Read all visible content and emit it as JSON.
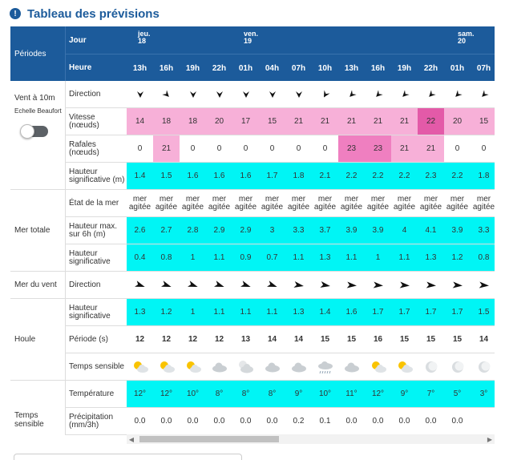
{
  "title": "Tableau des prévisions",
  "periods_header": "Périodes",
  "header": {
    "jour_label": "Jour",
    "heure_label": "Heure"
  },
  "days": [
    {
      "name": "jeu.",
      "date": "18"
    },
    {
      "name": "ven.",
      "date": "19"
    },
    {
      "name": "sam.",
      "date": "20"
    }
  ],
  "hours": [
    "13h",
    "16h",
    "19h",
    "22h",
    "01h",
    "04h",
    "07h",
    "10h",
    "13h",
    "16h",
    "19h",
    "22h",
    "01h",
    "07h"
  ],
  "sections": {
    "vent": {
      "title": "Vent à 10m",
      "subtitle": "Echelle Beaufort"
    },
    "mer_totale": "Mer totale",
    "mer_du_vent": "Mer du vent",
    "houle": "Houle",
    "temps": "Temps sensible"
  },
  "labels": {
    "direction": "Direction",
    "vitesse": "Vitesse (nœuds)",
    "rafales": "Rafales (nœuds)",
    "hauteur_sig": "Hauteur significative (m)",
    "etat_mer": "État de la mer",
    "hauteur_max": "Hauteur max. sur 6h (m)",
    "hauteur_sig_vent": "Hauteur significative",
    "houle_direction": "Direction",
    "houle_hauteur": "Hauteur significative",
    "periode": "Période (s)",
    "temps_sensible": "Temps sensible",
    "temperature": "Température",
    "precipitation": "Précipitation (mm/3h)"
  },
  "wind_direction_deg": [
    0,
    315,
    0,
    0,
    0,
    0,
    0,
    30,
    45,
    45,
    45,
    45,
    45,
    45
  ],
  "vitesse": [
    "14",
    "18",
    "18",
    "20",
    "17",
    "15",
    "21",
    "21",
    "21",
    "21",
    "21",
    "22",
    "20",
    "15"
  ],
  "rafales": [
    "0",
    "21",
    "0",
    "0",
    "0",
    "0",
    "0",
    "0",
    "23",
    "23",
    "21",
    "21",
    "0",
    "0"
  ],
  "hauteur_sig": [
    "1.4",
    "1.5",
    "1.6",
    "1.6",
    "1.6",
    "1.7",
    "1.8",
    "2.1",
    "2.2",
    "2.2",
    "2.2",
    "2.3",
    "2.2",
    "1.8"
  ],
  "etat_mer": {
    "line1": "mer",
    "line2": "agitée"
  },
  "hauteur_max": [
    "2.6",
    "2.7",
    "2.8",
    "2.9",
    "2.9",
    "3",
    "3.3",
    "3.7",
    "3.9",
    "3.9",
    "4",
    "4.1",
    "3.9",
    "3.3"
  ],
  "hauteur_sig_vent": [
    "0.4",
    "0.8",
    "1",
    "1.1",
    "0.9",
    "0.7",
    "1.1",
    "1.3",
    "1.1",
    "1",
    "1.1",
    "1.3",
    "1.2",
    "0.8"
  ],
  "houle_direction_deg": [
    110,
    110,
    110,
    110,
    110,
    110,
    100,
    100,
    95,
    95,
    95,
    95,
    95,
    95
  ],
  "houle_hauteur": [
    "1.3",
    "1.2",
    "1",
    "1.1",
    "1.1",
    "1.1",
    "1.3",
    "1.4",
    "1.6",
    "1.7",
    "1.7",
    "1.7",
    "1.7",
    "1.5"
  ],
  "periode": [
    "12",
    "12",
    "12",
    "12",
    "13",
    "14",
    "14",
    "15",
    "15",
    "16",
    "15",
    "15",
    "15",
    "14"
  ],
  "weather_icons": [
    "sun-cloud",
    "sun-cloud",
    "sun-cloud",
    "cloud",
    "cloud-moon",
    "cloud",
    "cloud",
    "cloud-drizzle",
    "cloud",
    "sun-cloud",
    "sun-cloud",
    "moon",
    "moon",
    "moon"
  ],
  "temperature": [
    "12°",
    "12°",
    "10°",
    "8°",
    "8°",
    "8°",
    "9°",
    "10°",
    "11°",
    "12°",
    "9°",
    "7°",
    "5°",
    "3°"
  ],
  "precipitation": [
    "0.0",
    "0.0",
    "0.0",
    "0.0",
    "0.0",
    "0.0",
    "0.2",
    "0.1",
    "0.0",
    "0.0",
    "0.0",
    "0.0",
    "0.0",
    ""
  ],
  "colors": {
    "header_blue": "#1c5b9b",
    "cyan": "#00f5f5",
    "pink_light": "#f7b0d8",
    "pink_mid": "#ef7fc0",
    "pink_dark": "#e35aa8"
  }
}
